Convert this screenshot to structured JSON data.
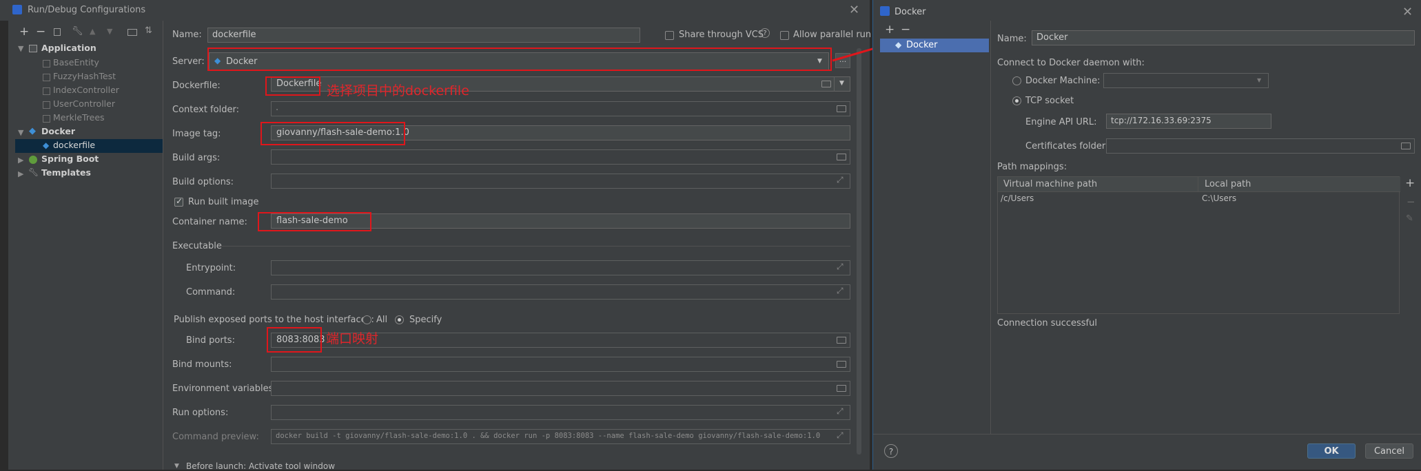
{
  "left_dialog": {
    "title": "Run/Debug Configurations",
    "toolbar": [
      "+",
      "−"
    ],
    "tree": {
      "application": {
        "label": "Application",
        "children": [
          "BaseEntity",
          "FuzzyHashTest",
          "IndexController",
          "UserController",
          "MerkleTrees"
        ]
      },
      "docker": {
        "label": "Docker",
        "children": [
          "dockerfile"
        ]
      },
      "spring_boot": {
        "label": "Spring Boot"
      },
      "templates": {
        "label": "Templates"
      }
    },
    "name_label": "Name:",
    "name_value": "dockerfile",
    "share_vcs": "Share through VCS",
    "allow_parallel": "Allow parallel run",
    "server_label": "Server:",
    "server_value": "Docker",
    "dockerfile_label": "Dockerfile:",
    "dockerfile_value": "Dockerfile",
    "annotation_dockerfile": "选择项目中的dockerfile",
    "context_label": "Context folder:",
    "context_value": ".",
    "image_tag_label": "Image tag:",
    "image_tag_value": "giovanny/flash-sale-demo:1.0",
    "build_args_label": "Build args:",
    "build_options_label": "Build options:",
    "run_built_image": "Run built image",
    "container_name_label": "Container name:",
    "container_name_value": "flash-sale-demo",
    "executable_label": "Executable",
    "entrypoint_label": "Entrypoint:",
    "command_label": "Command:",
    "publish_label": "Publish exposed ports to the host interfaces:",
    "publish_all": "All",
    "publish_specify": "Specify",
    "bind_ports_label": "Bind ports:",
    "bind_ports_value": "8083:8083",
    "annotation_ports": "端口映射",
    "bind_mounts_label": "Bind mounts:",
    "env_vars_label": "Environment variables:",
    "run_options_label": "Run options:",
    "command_preview_label": "Command preview:",
    "command_preview_value": "docker build -t giovanny/flash-sale-demo:1.0 . && docker run -p 8083:8083 --name flash-sale-demo giovanny/flash-sale-demo:1.0",
    "before_launch": "Before launch: Activate tool window"
  },
  "right_dialog": {
    "title": "Docker",
    "toolbar": [
      "+",
      "−"
    ],
    "list_item": "Docker",
    "name_label": "Name:",
    "name_value": "Docker",
    "connect_label": "Connect to Docker daemon with:",
    "docker_machine_label": "Docker Machine:",
    "tcp_socket_label": "TCP socket",
    "engine_api_label": "Engine API URL:",
    "engine_api_value": "tcp://172.16.33.69:2375",
    "certs_label": "Certificates folder:",
    "path_mappings_label": "Path mappings:",
    "table_headers": [
      "Virtual machine path",
      "Local path"
    ],
    "table_rows": [
      [
        "/c/Users",
        "C:\\Users"
      ]
    ],
    "status": "Connection successful",
    "help": "?",
    "ok": "OK",
    "cancel": "Cancel"
  },
  "colors": {
    "accent": "#365880",
    "highlight_red": "#e0161b",
    "ok_button": "#365880"
  }
}
